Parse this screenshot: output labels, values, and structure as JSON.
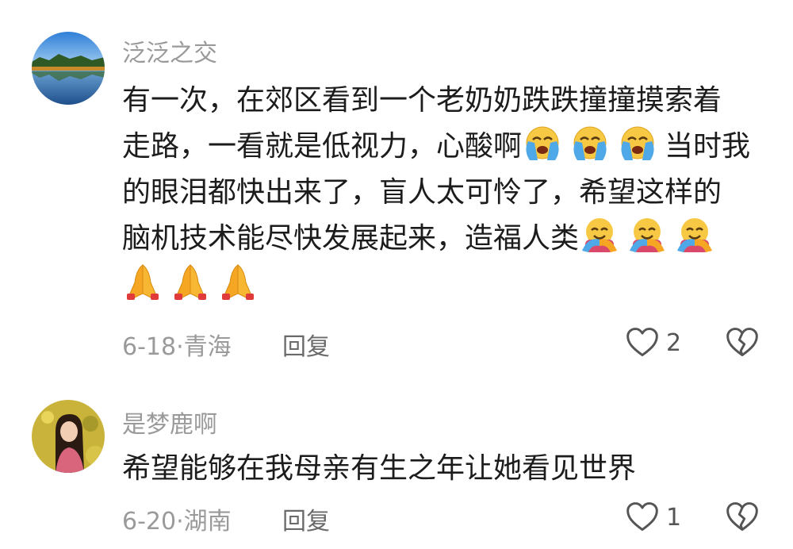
{
  "comments": [
    {
      "username": "泛泛之交",
      "text_lines": [
        "有一次，在郊区看到一个老奶奶跌跌撞撞摸索着",
        "走路，一看就是低视力，心酸啊",
        "当时我",
        "的眼泪都快出来了，盲人太可怜了，希望这样的",
        "脑机技术能尽快发展起来，造福人类"
      ],
      "emojis": {
        "crying": "loudly-crying-face",
        "hugging": "hugging-face",
        "praying": "folded-hands"
      },
      "date_location": "6-18·青海",
      "reply_label": "回复",
      "like_count": "2"
    },
    {
      "username": "是梦鹿啊",
      "text_lines": [
        "希望能够在我母亲有生之年让她看见世界"
      ],
      "date_location": "6-20·湖南",
      "reply_label": "回复",
      "like_count": "1"
    }
  ],
  "colors": {
    "username": "#9a9a9a",
    "text": "#1c1c1c",
    "meta": "#9a9a9a",
    "icon": "#555555"
  }
}
